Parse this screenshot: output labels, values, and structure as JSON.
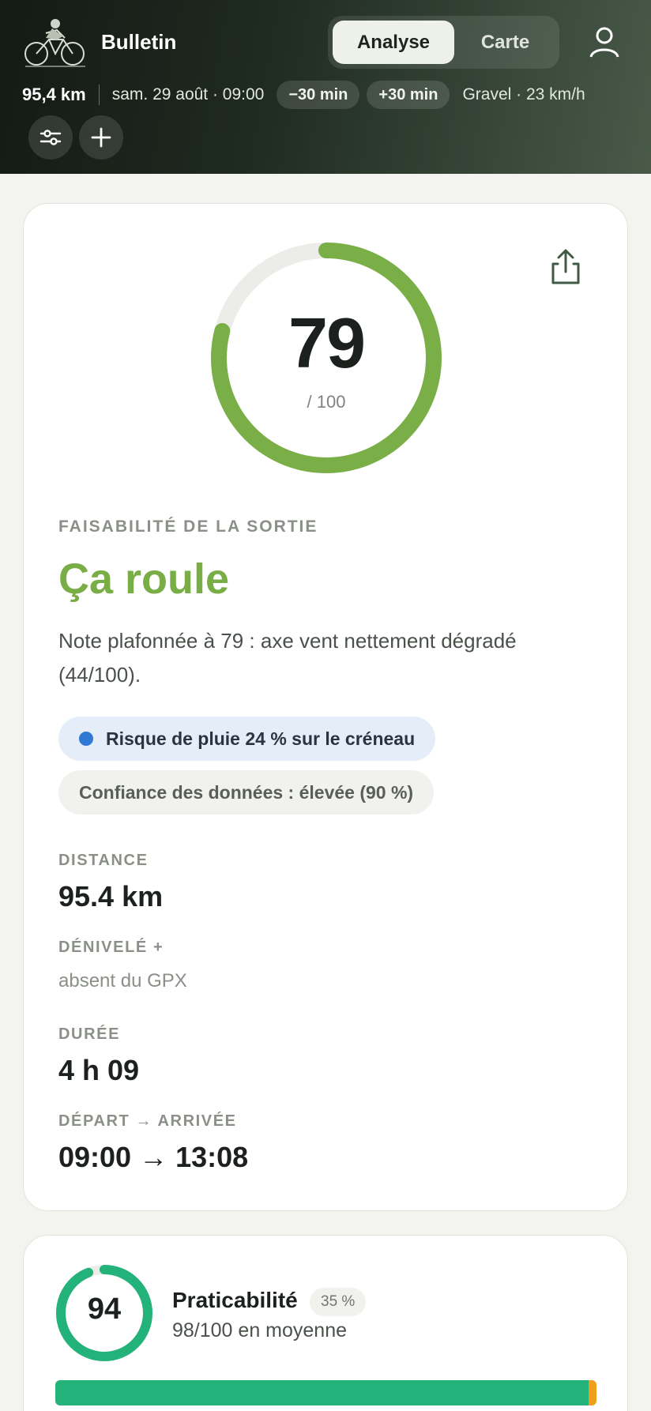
{
  "header": {
    "title": "Bulletin",
    "tabs": [
      {
        "label": "Analyse",
        "active": true
      },
      {
        "label": "Carte",
        "active": false
      }
    ],
    "distance": "95,4 km",
    "datetime": "sam. 29 août · 09:00",
    "shift_minus": "−30 min",
    "shift_plus": "+30 min",
    "profile": "Gravel · 23 km/h",
    "icons": [
      "cyclist-logo",
      "user-icon",
      "sliders-icon",
      "plus-icon"
    ]
  },
  "score": {
    "value": "79",
    "max": "/ 100",
    "fraction": 0.79,
    "color": "#7aae46",
    "track_color": "#ecede8"
  },
  "feasibility": {
    "label": "FAISABILITÉ DE LA SORTIE",
    "verdict": "Ça roule",
    "note": "Note plafonnée à 79 : axe vent nettement dégradé (44/100).",
    "rain_chip": "Risque de pluie 24 % sur le créneau",
    "confidence_chip": "Confiance des données : élevée (90 %)"
  },
  "stats": [
    {
      "label": "DISTANCE",
      "value": "95.4 km"
    },
    {
      "label": "DÉNIVELÉ +",
      "value": "absent du GPX"
    },
    {
      "label": "DURÉE",
      "value": "4 h 09"
    },
    {
      "label": "DÉPART → ARRIVÉE",
      "value": "09:00 → 13:08"
    }
  ],
  "praticabilite": {
    "score": "94",
    "fraction": 0.94,
    "title": "Praticabilité",
    "weight": "35 %",
    "subtitle": "98/100 en moyenne",
    "bar_good_fraction": 0.985,
    "bar_warn_fraction": 0.015,
    "color": "#22b27a"
  }
}
